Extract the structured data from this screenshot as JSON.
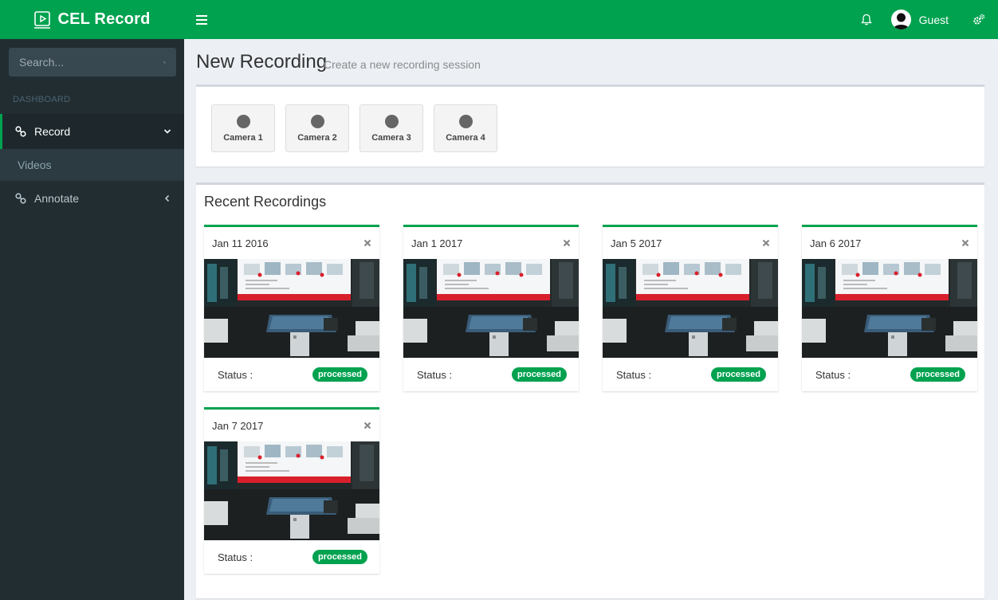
{
  "app": {
    "logo_text": "CEL Record"
  },
  "sidebar": {
    "search_placeholder": "Search...",
    "section_header": "DASHBOARD",
    "items": [
      {
        "label": "Record",
        "active": true
      },
      {
        "label": "Videos"
      },
      {
        "label": "Annotate"
      }
    ]
  },
  "topbar": {
    "user_name": "Guest"
  },
  "page": {
    "title": "New Recording",
    "subtitle": "Create a new recording session"
  },
  "cameras": [
    "Camera 1",
    "Camera 2",
    "Camera 3",
    "Camera 4"
  ],
  "recordings": {
    "title": "Recent Recordings",
    "status_label": "Status :",
    "items": [
      {
        "date": "Jan 11 2016",
        "status": "processed"
      },
      {
        "date": "Jan 1 2017",
        "status": "processed"
      },
      {
        "date": "Jan 5 2017",
        "status": "processed"
      },
      {
        "date": "Jan 6 2017",
        "status": "processed"
      },
      {
        "date": "Jan 7 2017",
        "status": "processed"
      }
    ]
  },
  "colors": {
    "brand": "#00a24f",
    "sidebar": "#222d32",
    "background": "#ecf0f5"
  }
}
